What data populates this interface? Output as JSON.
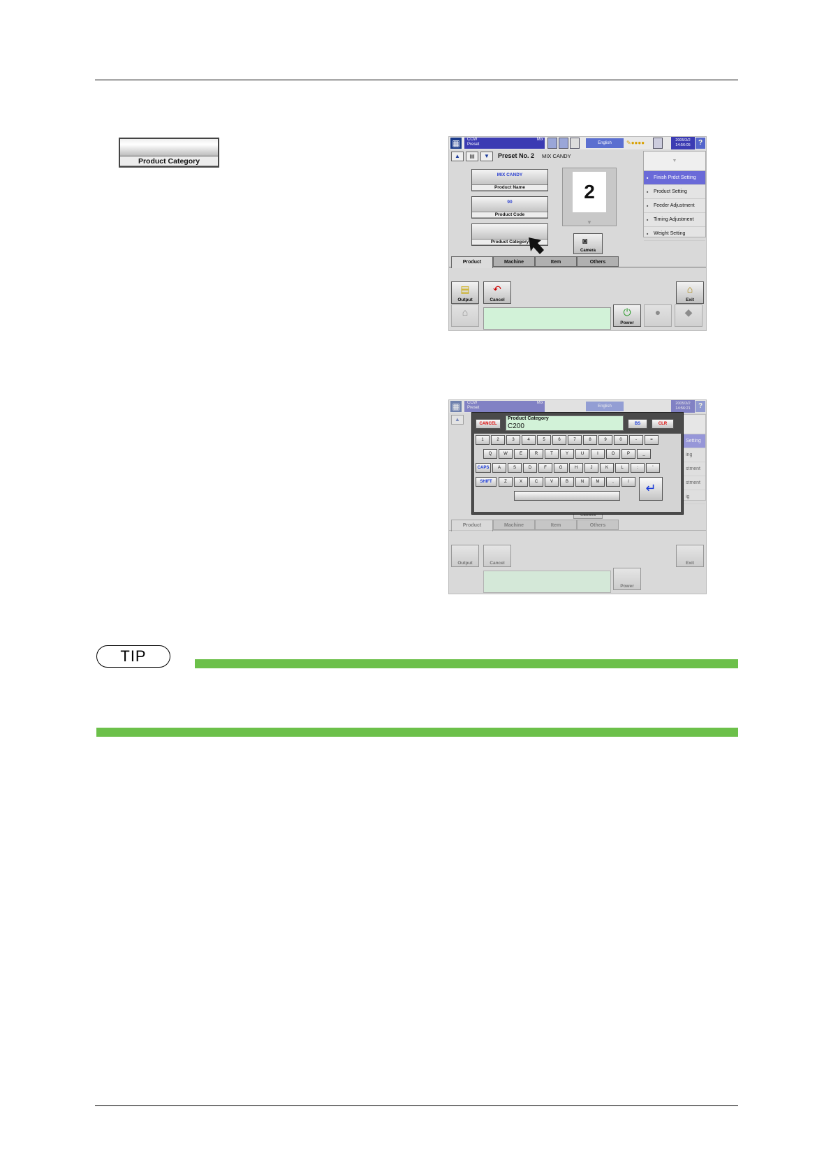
{
  "icon_button": {
    "label": "Product Category"
  },
  "screen1": {
    "header": {
      "mode_line1": "CCW",
      "mode_line2": "Preset",
      "mode_tag": "Mix",
      "language": "English",
      "clock_line1": "2005/3/2",
      "clock_line2": "14:56:05"
    },
    "preset_label": "Preset No. 2",
    "product_name_display": "MIX CANDY",
    "fields": [
      {
        "value": "MIX CANDY",
        "caption": "Product Name"
      },
      {
        "value": "90",
        "caption": "Product Code"
      },
      {
        "value": "",
        "caption": "Product Category"
      }
    ],
    "preset_number": "2",
    "camera_label": "Camera",
    "menu": [
      "Finish Prdct Setting",
      "Product Setting",
      "Feeder Adjustment",
      "Timing Adjustment",
      "Weight Setting"
    ],
    "tabs": [
      "Product",
      "Machine",
      "Item",
      "Others"
    ],
    "toolbar": {
      "output": "Output",
      "cancel": "Cancel",
      "exit": "Exit",
      "power": "Power"
    }
  },
  "screen2": {
    "header": {
      "clock_line1": "2005/3/2",
      "clock_line2": "14:56:21"
    },
    "keyboard": {
      "cancel": "CANCEL",
      "bs": "BS",
      "clr": "CLR",
      "field_title": "Product Category",
      "field_value": "C200",
      "row1": [
        "1",
        "2",
        "3",
        "4",
        "5",
        "6",
        "7",
        "8",
        "9",
        "0",
        "-",
        "="
      ],
      "row2": [
        "Q",
        "W",
        "E",
        "R",
        "T",
        "Y",
        "U",
        "I",
        "O",
        "P",
        "_"
      ],
      "row3": [
        "CAPS",
        "A",
        "S",
        "D",
        "F",
        "G",
        "H",
        "J",
        "K",
        "L",
        ":",
        "'"
      ],
      "row4": [
        "SHIFT",
        "Z",
        "X",
        "C",
        "V",
        "B",
        "N",
        "M",
        ",",
        "/"
      ]
    },
    "menu_fragments": [
      "Setting",
      "ing",
      "stment",
      "stment",
      "ig"
    ],
    "camera_label": "Camera"
  },
  "tip": {
    "label": "TIP"
  }
}
